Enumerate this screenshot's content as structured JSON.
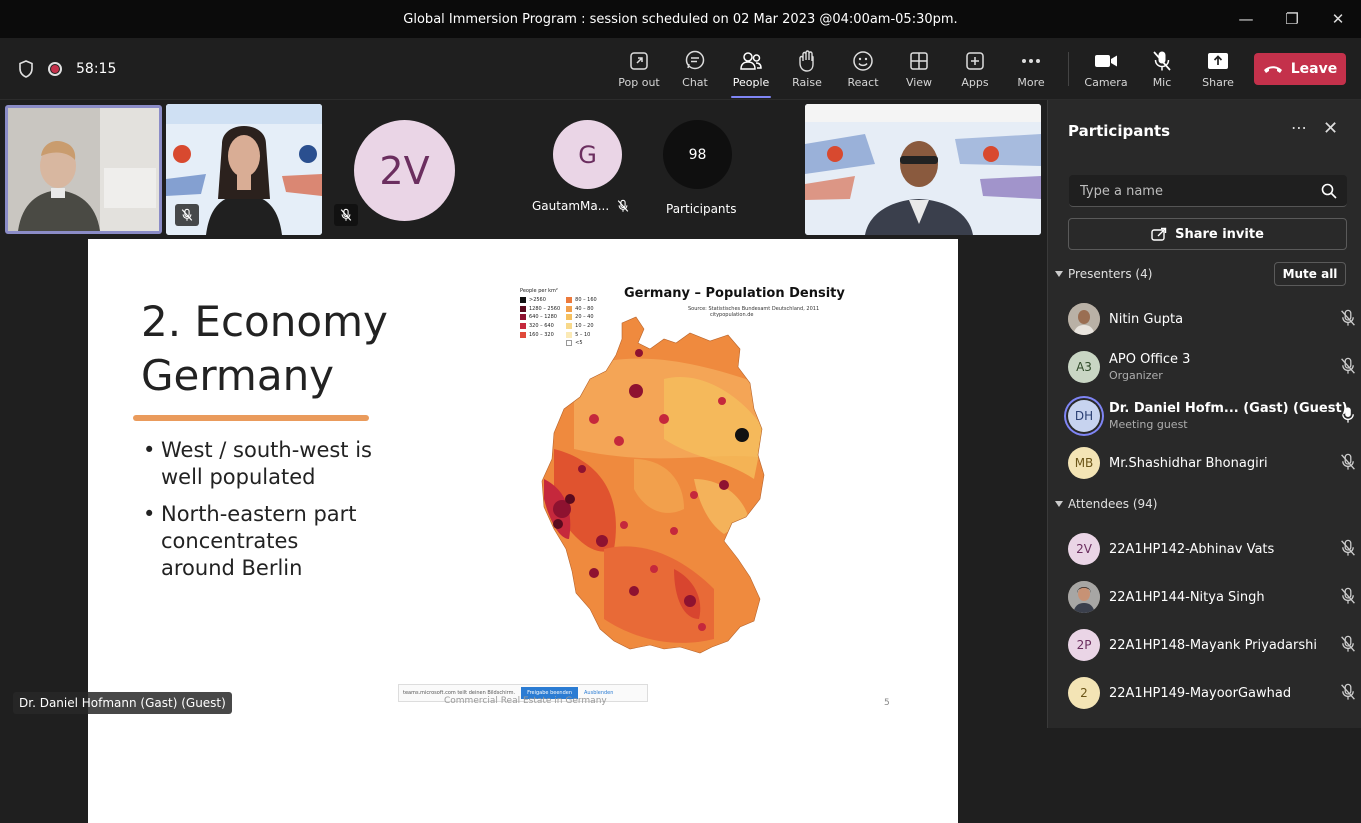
{
  "window": {
    "title": "Global Immersion Program : session scheduled on 02 Mar 2023 @04:00am-05:30pm."
  },
  "meeting": {
    "timer": "58:15"
  },
  "toolbar": {
    "buttons": [
      {
        "label": "Pop out",
        "icon": "pop-out-icon"
      },
      {
        "label": "Chat",
        "icon": "chat-icon"
      },
      {
        "label": "People",
        "icon": "people-icon"
      },
      {
        "label": "Raise",
        "icon": "raise-hand-icon"
      },
      {
        "label": "React",
        "icon": "react-icon"
      },
      {
        "label": "View",
        "icon": "view-icon"
      },
      {
        "label": "Apps",
        "icon": "apps-icon"
      },
      {
        "label": "More",
        "icon": "more-icon"
      }
    ],
    "camera": "Camera",
    "mic": "Mic",
    "share": "Share",
    "leave": "Leave"
  },
  "gallery": {
    "tile_2v": "2V",
    "tile_g_initial": "G",
    "tile_g_name": "GautamMa...",
    "participants_count": "98",
    "participants_label": "Participants"
  },
  "slide": {
    "title_line1": "2. Economy",
    "title_line2": "Germany",
    "bullet1": "West / south-west is well populated",
    "bullet2": "North-eastern part concentrates around Berlin",
    "map_title": "Germany – Population Density",
    "map_source": "Source: Statistisches Bundesamt Deutschland, 2011",
    "map_source2": "citypopulation.de",
    "legend_header": "People per km²",
    "legend_left": [
      ">2560",
      "1280 – 2560",
      "640 – 1280",
      "320 – 640",
      "160 – 320"
    ],
    "legend_right": [
      "80 – 160",
      "40 – 80",
      "20 – 40",
      "10 – 20",
      "5 – 10",
      "<5"
    ],
    "footer": "Commercial Real Estate in Germany",
    "page_number": "5",
    "banner_text": "teams.microsoft.com teilt deinen Bildschirm.",
    "banner_btn": "Freigabe beenden",
    "banner_link": "Ausblenden"
  },
  "speaker_label": "Dr. Daniel Hofmann (Gast) (Guest)",
  "panel": {
    "title": "Participants",
    "search_placeholder": "Type a name",
    "share_invite": "Share invite",
    "presenters_header": "Presenters (4)",
    "mute_all": "Mute all",
    "attendees_header": "Attendees (94)",
    "presenters": [
      {
        "name": "Nitin Gupta",
        "role": "",
        "initials": "",
        "color": "#8a7d6d"
      },
      {
        "name": "APO Office 3",
        "role": "Organizer",
        "initials": "A3",
        "color": "#c9d6c4"
      },
      {
        "name": "Dr. Daniel Hofm... (Gast) (Guest)",
        "role": "Meeting guest",
        "initials": "DH",
        "color": "#c7d3ef"
      },
      {
        "name": "Mr.Shashidhar Bhonagiri",
        "role": "",
        "initials": "MB",
        "color": "#f3e4b5"
      }
    ],
    "attendees": [
      {
        "name": "22A1HP142-Abhinav Vats",
        "initials": "2V",
        "color": "#ead5e6"
      },
      {
        "name": "22A1HP144-Nitya Singh",
        "initials": "",
        "color": "#8a7d6d"
      },
      {
        "name": "22A1HP148-Mayank Priyadarshi",
        "initials": "2P",
        "color": "#ead5e6"
      },
      {
        "name": "22A1HP149-MayoorGawhad",
        "initials": "2",
        "color": "#f3e4b5"
      }
    ]
  },
  "colors": {
    "accent": "#7f85f5",
    "leave": "#c4314b",
    "panel_bg": "#292929"
  }
}
